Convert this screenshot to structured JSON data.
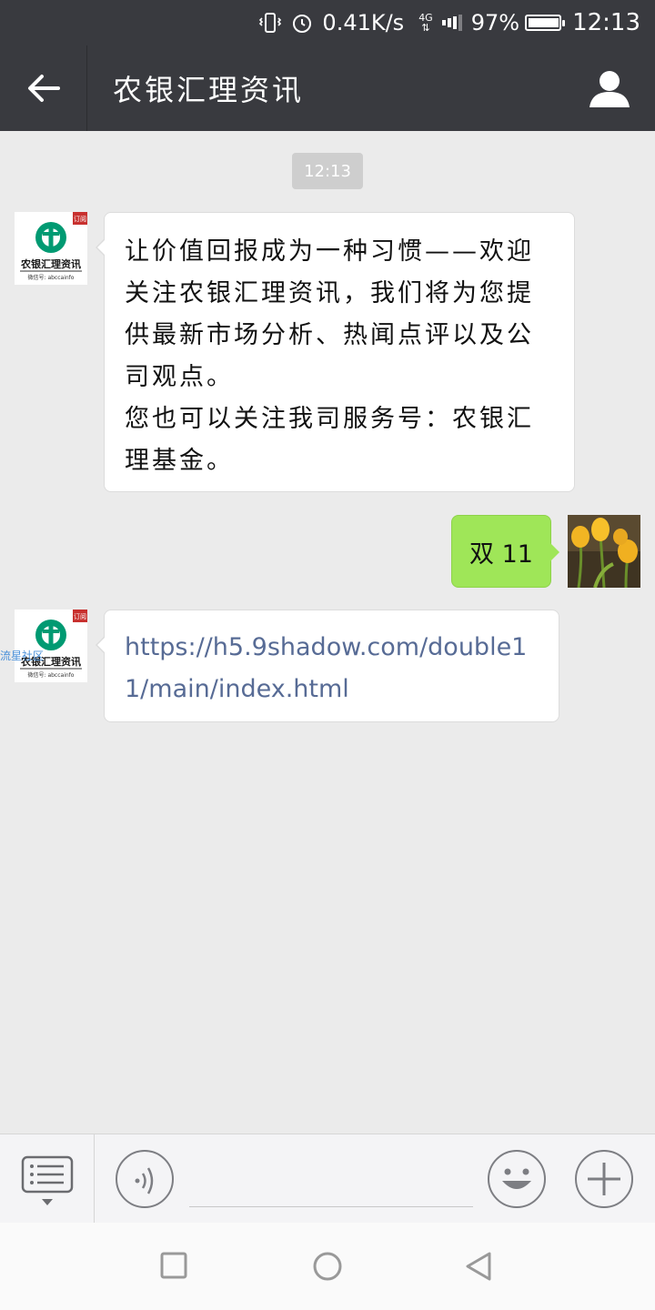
{
  "status_bar": {
    "speed": "0.41K/s",
    "network": "4G",
    "battery": "97%",
    "battery_level": 0.97,
    "time": "12:13"
  },
  "header": {
    "title": "农银汇理资讯"
  },
  "chat": {
    "timestamp": "12:13",
    "messages": [
      {
        "sender": "official-account",
        "lines": [
          "让价值回报成为一种习惯——欢迎关注农银汇理资讯，我们将为您提供最新市场分析、热闻点评以及公司观点。",
          "您也可以关注我司服务号：农银汇理基金。"
        ]
      },
      {
        "sender": "me",
        "text": "双 11"
      },
      {
        "sender": "official-account",
        "link": "https://h5.9shadow.com/double11/main/index.html"
      }
    ],
    "avatar_left": {
      "badge": "订阅",
      "brand": "农银汇理资讯",
      "sub": "微信号: abccainfo",
      "watermark": "流星社区"
    }
  },
  "input_bar": {
    "placeholder": ""
  },
  "colors": {
    "topbar": "#393a3f",
    "chat_bg": "#ebebeb",
    "green_bubble": "#9fe658",
    "link": "#576b95",
    "abc_green": "#009a72"
  }
}
